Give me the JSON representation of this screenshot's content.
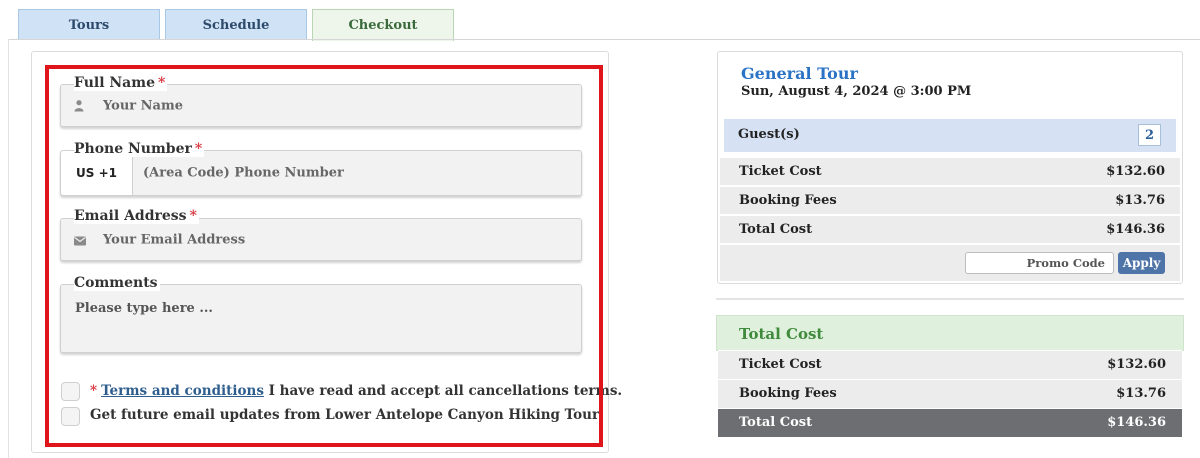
{
  "tabs": [
    {
      "label": "Tours"
    },
    {
      "label": "Schedule"
    },
    {
      "label": "Checkout"
    }
  ],
  "form": {
    "full_name": {
      "label": "Full Name",
      "required": "*",
      "placeholder": "Your Name",
      "icon": "user-icon"
    },
    "phone": {
      "label": "Phone Number",
      "required": "*",
      "country_code": "US +1",
      "placeholder": "(Area Code) Phone Number"
    },
    "email": {
      "label": "Email Address",
      "required": "*",
      "placeholder": "Your Email Address",
      "icon": "envelope-icon"
    },
    "comments": {
      "label": "Comments",
      "placeholder": "Please type here ..."
    },
    "terms": {
      "required": "*",
      "link_text": "Terms and conditions",
      "text": "I have read and accept all cancellations terms."
    },
    "updates": {
      "text": "Get future email updates from Lower Antelope Canyon Hiking Tour."
    }
  },
  "summary": {
    "tour_title": "General Tour",
    "tour_date": "Sun, August 4, 2024 @ 3:00 PM",
    "guests_label": "Guest(s)",
    "guests_count": "2",
    "rows": [
      {
        "label": "Ticket Cost",
        "value": "$132.60"
      },
      {
        "label": "Booking Fees",
        "value": "$13.76"
      },
      {
        "label": "Total Cost",
        "value": "$146.36"
      }
    ],
    "promo_placeholder": "Promo Code",
    "apply_label": "Apply"
  },
  "total": {
    "heading": "Total Cost",
    "rows": [
      {
        "label": "Ticket Cost",
        "value": "$132.60"
      },
      {
        "label": "Booking Fees",
        "value": "$13.76"
      },
      {
        "label": "Total Cost",
        "value": "$146.36"
      }
    ]
  },
  "colors": {
    "tab_bg": "#cfe2f6",
    "active_tab_bg": "#eef6ec",
    "highlight_border": "#e0141b",
    "link": "#2e5e8e",
    "tour_title": "#2a73c5",
    "apply_button": "#4f74a8",
    "total_heading": "#3f8a3d",
    "total_row_dark": "#6d6e71"
  }
}
